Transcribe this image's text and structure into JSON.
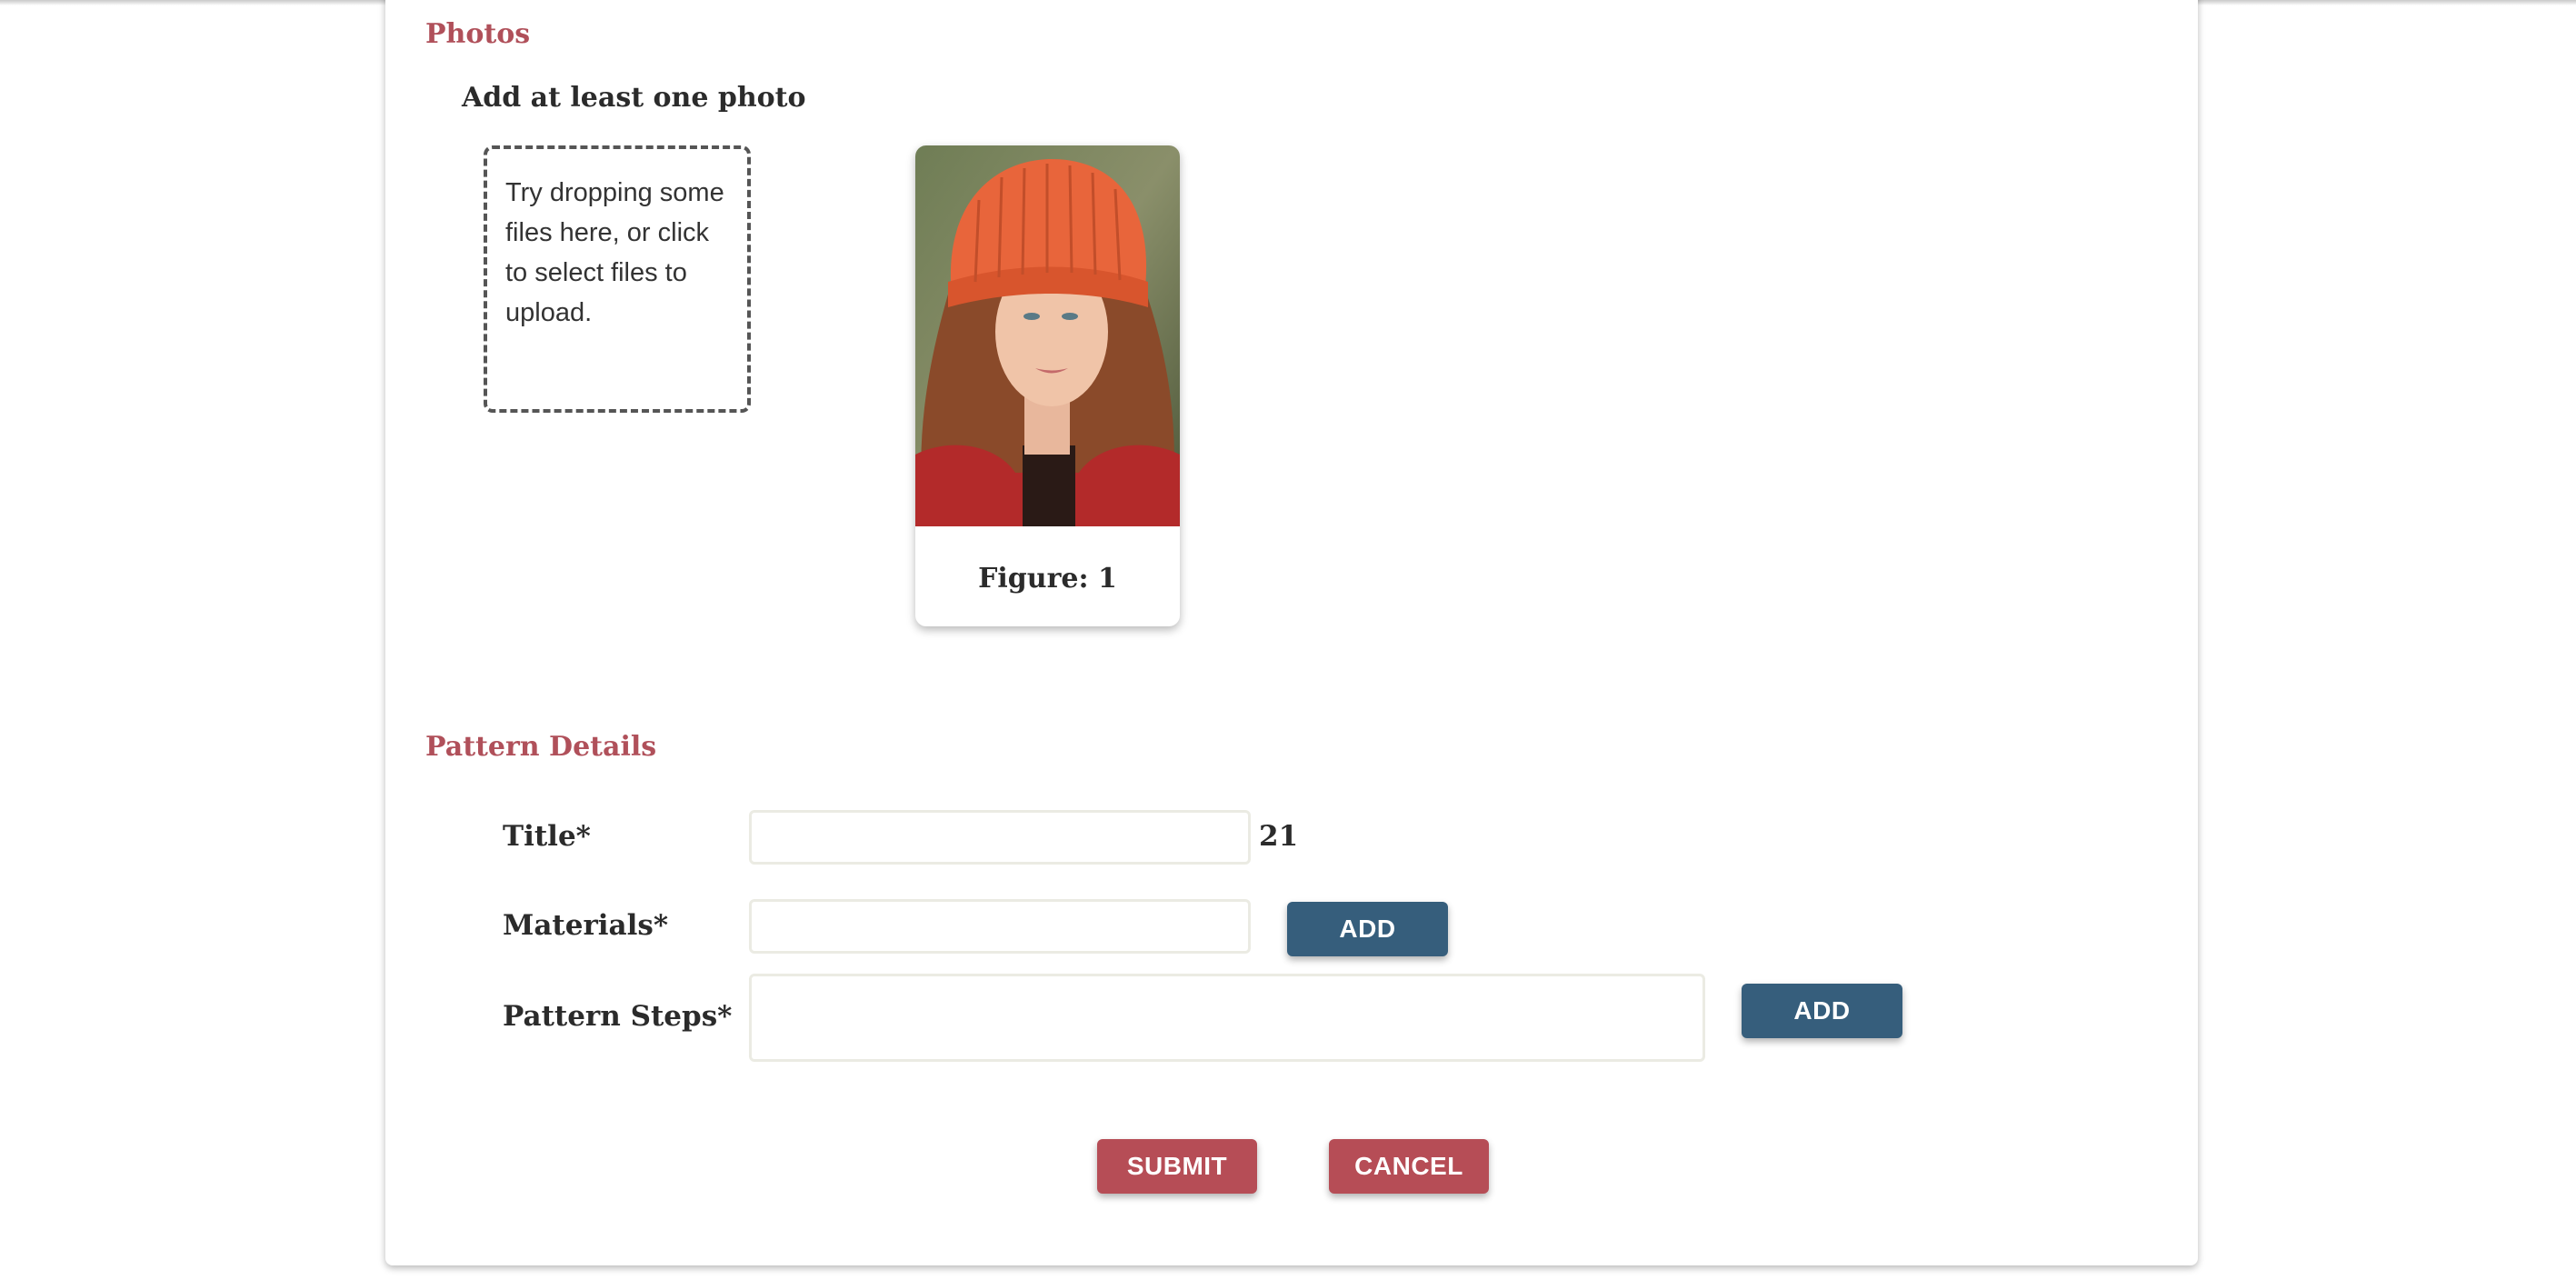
{
  "photos": {
    "title": "Photos",
    "instruction": "Add at least one photo",
    "dropzone_text": "Try dropping some files here, or click to select files to upload.",
    "figures": [
      {
        "caption": "Figure: 1",
        "description": "Woman wearing an orange knitted beanie and red jacket"
      }
    ]
  },
  "details": {
    "title": "Pattern Details",
    "fields": {
      "title": {
        "label": "Title*",
        "value": "",
        "counter": "21"
      },
      "materials": {
        "label": "Materials*",
        "value": "",
        "add_label": "ADD"
      },
      "steps": {
        "label": "Pattern Steps*",
        "value": "",
        "add_label": "ADD"
      }
    }
  },
  "actions": {
    "submit_label": "SUBMIT",
    "cancel_label": "CANCEL"
  },
  "colors": {
    "accent": "#b0505a",
    "primary_button": "#365e7c",
    "danger_button": "#b64d56"
  }
}
